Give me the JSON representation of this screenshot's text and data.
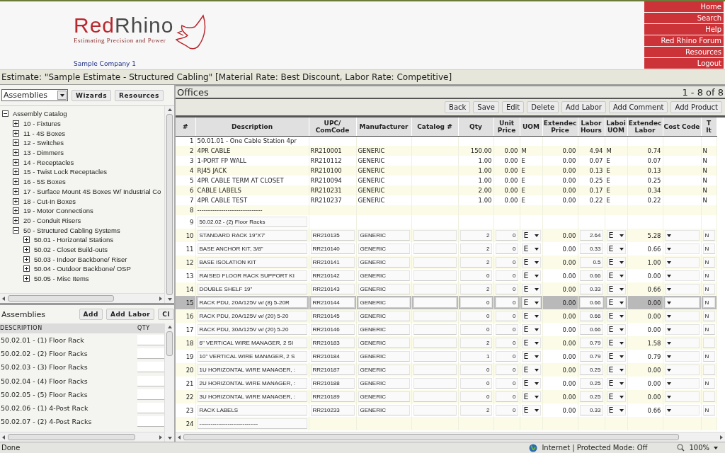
{
  "header": {
    "logo": {
      "part1": "Red",
      "part2": "Rhino",
      "tagline": "Estimating Precision and Power"
    },
    "company": "Sample Company 1",
    "nav": [
      "Home",
      "Search",
      "Help",
      "Red Rhino Forum",
      "Resources",
      "Logout"
    ]
  },
  "estimate_bar": "Estimate: \"Sample Estimate - Structured Cabling\" [Material Rate: Best Discount, Labor Rate: Competitive]",
  "left_panel": {
    "dropdown": "Assemblies",
    "buttons": [
      "Wizards",
      "Resources"
    ],
    "tree": {
      "label": "Assembly Catalog",
      "expanded": true,
      "children": [
        {
          "label": "10 - Fixtures",
          "expanded": false
        },
        {
          "label": "11 - 4S Boxes",
          "expanded": false
        },
        {
          "label": "12 - Switches",
          "expanded": false
        },
        {
          "label": "13 - Dimmers",
          "expanded": false
        },
        {
          "label": "14 - Receptacles",
          "expanded": false
        },
        {
          "label": "15 - Twist Lock Receptacles",
          "expanded": false
        },
        {
          "label": "16 - 5S Boxes",
          "expanded": false
        },
        {
          "label": "17 - Surface Mount 4S Boxes W/ Industrial Co",
          "expanded": false
        },
        {
          "label": "18 - Cut-In Boxes",
          "expanded": false
        },
        {
          "label": "19 - Motor Connections",
          "expanded": false
        },
        {
          "label": "20 - Conduit Risers",
          "expanded": false
        },
        {
          "label": "50 - Structured Cabling Systems",
          "expanded": true,
          "children": [
            {
              "label": "50.01 - Horizontal Stations",
              "expanded": false
            },
            {
              "label": "50.02 - Closet Build-outs",
              "expanded": false
            },
            {
              "label": "50.03 - Indoor Backbone/ Riser",
              "expanded": false
            },
            {
              "label": "50.04 - Outdoor Backbone/ OSP",
              "expanded": false
            },
            {
              "label": "50.05 - Misc Items",
              "expanded": false
            }
          ]
        }
      ]
    }
  },
  "assemblies": {
    "title": "Assemblies",
    "buttons": [
      "Add",
      "Add Labor",
      "Cl"
    ],
    "columns": [
      "DESCRIPTION",
      "QTY"
    ],
    "rows": [
      "50.02.01 - (1) Floor Rack",
      "50.02.02 - (2) Floor Racks",
      "50.02.03 - (3) Floor Racks",
      "50.02.04 - (4) Floor Racks",
      "50.02.05 - (5) Floor Racks",
      "50.02.06 - (1) 4-Post Rack",
      "50.02.07 - (2) 4-Post Racks"
    ]
  },
  "main": {
    "title": "Offices",
    "paging": "1 - 8 of 8",
    "buttons": [
      "Back",
      "Save",
      "Edit",
      "Delete",
      "Add Labor",
      "Add Comment",
      "Add Product"
    ],
    "columns": [
      [
        "#"
      ],
      [
        "Description"
      ],
      [
        "UPC/",
        "ComCode"
      ],
      [
        "Manufacturer"
      ],
      [
        "Catalog #"
      ],
      [
        "Qty"
      ],
      [
        "Unit",
        "Price"
      ],
      [
        "UOM"
      ],
      [
        "Extendec",
        "Price"
      ],
      [
        "Labor",
        "Hours"
      ],
      [
        "Laboi",
        "UOM"
      ],
      [
        "Extendec",
        "Labor"
      ],
      [
        "Cost Code"
      ],
      [
        "T",
        "It"
      ]
    ],
    "rows": [
      {
        "kind": "plain",
        "selected": false,
        "num": "1",
        "description": "50.01.01 - One Cable Station 4pr"
      },
      {
        "kind": "plain",
        "selected": false,
        "num": "2",
        "description": "4PR CABLE",
        "upc": "RR210001",
        "manufacturer": "GENERIC",
        "qty": "150.00",
        "unit_price": "0.00",
        "uom": "M",
        "ext_price": "0.00",
        "labor_hours": "4.94",
        "labor_uom": "M",
        "ext_labor": "0.74",
        "flag": "N"
      },
      {
        "kind": "plain",
        "selected": false,
        "num": "3",
        "description": "1-PORT FP WALL",
        "upc": "RR210112",
        "manufacturer": "GENERIC",
        "qty": "1.00",
        "unit_price": "0.00",
        "uom": "E",
        "ext_price": "0.00",
        "labor_hours": "0.07",
        "labor_uom": "E",
        "ext_labor": "0.07",
        "flag": "N"
      },
      {
        "kind": "plain",
        "selected": false,
        "num": "4",
        "description": "RJ45 JACK",
        "upc": "RR210100",
        "manufacturer": "GENERIC",
        "qty": "1.00",
        "unit_price": "0.00",
        "uom": "E",
        "ext_price": "0.00",
        "labor_hours": "0.13",
        "labor_uom": "E",
        "ext_labor": "0.13",
        "flag": "N"
      },
      {
        "kind": "plain",
        "selected": false,
        "num": "5",
        "description": "4PR CABLE TERM AT CLOSET",
        "upc": "RR210094",
        "manufacturer": "GENERIC",
        "qty": "1.00",
        "unit_price": "0.00",
        "uom": "E",
        "ext_price": "0.00",
        "labor_hours": "0.25",
        "labor_uom": "E",
        "ext_labor": "0.25",
        "flag": "N"
      },
      {
        "kind": "plain",
        "selected": false,
        "num": "6",
        "description": "CABLE LABELS",
        "upc": "RR210231",
        "manufacturer": "GENERIC",
        "qty": "2.00",
        "unit_price": "0.00",
        "uom": "E",
        "ext_price": "0.00",
        "labor_hours": "0.17",
        "labor_uom": "E",
        "ext_labor": "0.34",
        "flag": "N"
      },
      {
        "kind": "plain",
        "selected": false,
        "num": "7",
        "description": "4PR CABLE TEST",
        "upc": "RR210237",
        "manufacturer": "GENERIC",
        "qty": "1.00",
        "unit_price": "0.00",
        "uom": "E",
        "ext_price": "0.00",
        "labor_hours": "0.22",
        "labor_uom": "E",
        "ext_labor": "0.22",
        "flag": "N"
      },
      {
        "kind": "plain",
        "selected": false,
        "num": "8",
        "description": "------------------------------"
      },
      {
        "kind": "label",
        "selected": false,
        "num": "9",
        "description": "50.02.02 - (2) Floor Racks"
      },
      {
        "kind": "entry",
        "selected": false,
        "num": "10",
        "description": "STANDARD RACK 19\"X7'",
        "upc": "RR210135",
        "manufacturer": "GENERIC",
        "qty": "2",
        "unit_price": "0",
        "uom": "E",
        "ext_price": "0.00",
        "labor_hours": "2.64",
        "labor_uom": "E",
        "ext_labor": "5.28",
        "flag": "N"
      },
      {
        "kind": "entry",
        "selected": false,
        "num": "11",
        "description": "BASE ANCHOR KIT, 3/8\"",
        "upc": "RR210140",
        "manufacturer": "GENERIC",
        "qty": "2",
        "unit_price": "0",
        "uom": "E",
        "ext_price": "0.00",
        "labor_hours": "0.33",
        "labor_uom": "E",
        "ext_labor": "0.66",
        "flag": "N"
      },
      {
        "kind": "entry",
        "selected": false,
        "num": "12",
        "description": "BASE ISOLATION KIT",
        "upc": "RR210141",
        "manufacturer": "GENERIC",
        "qty": "2",
        "unit_price": "0",
        "uom": "E",
        "ext_price": "0.00",
        "labor_hours": "0.5",
        "labor_uom": "E",
        "ext_labor": "1.00",
        "flag": "N"
      },
      {
        "kind": "entry",
        "selected": false,
        "num": "13",
        "description": "RAISED FLOOR RACK SUPPORT KI",
        "upc": "RR210142",
        "manufacturer": "GENERIC",
        "qty": "0",
        "unit_price": "0",
        "uom": "E",
        "ext_price": "0.00",
        "labor_hours": "0.66",
        "labor_uom": "E",
        "ext_labor": "0.00",
        "flag": "N"
      },
      {
        "kind": "entry",
        "selected": false,
        "num": "14",
        "description": "DOUBLE SHELF 19\"",
        "upc": "RR210143",
        "manufacturer": "GENERIC",
        "qty": "2",
        "unit_price": "0",
        "uom": "E",
        "ext_price": "0.00",
        "labor_hours": "0.33",
        "labor_uom": "E",
        "ext_labor": "0.66",
        "flag": "N"
      },
      {
        "kind": "entry",
        "selected": true,
        "num": "15",
        "description": "RACK PDU, 20A/125V w/ (8) 5-20R",
        "upc": "RR210144",
        "manufacturer": "GENERIC",
        "qty": "0",
        "unit_price": "0",
        "uom": "E",
        "ext_price": "0.00",
        "labor_hours": "0.66",
        "labor_uom": "E",
        "ext_labor": "0.00",
        "flag": "N"
      },
      {
        "kind": "entry",
        "selected": false,
        "num": "16",
        "description": "RACK PDU, 20A/125V w/ (20) 5-20",
        "upc": "RR210145",
        "manufacturer": "GENERIC",
        "qty": "0",
        "unit_price": "0",
        "uom": "E",
        "ext_price": "0.00",
        "labor_hours": "0.66",
        "labor_uom": "E",
        "ext_labor": "0.00",
        "flag": "N"
      },
      {
        "kind": "entry",
        "selected": false,
        "num": "17",
        "description": "RACK PDU, 30A/125V w/ (20) 5-20",
        "upc": "RR210146",
        "manufacturer": "GENERIC",
        "qty": "0",
        "unit_price": "0",
        "uom": "E",
        "ext_price": "0.00",
        "labor_hours": "0.66",
        "labor_uom": "E",
        "ext_labor": "0.00",
        "flag": "N"
      },
      {
        "kind": "entry",
        "selected": false,
        "num": "18",
        "description": "6\" VERTICAL WIRE MANAGER, 2 SI",
        "upc": "RR210183",
        "manufacturer": "GENERIC",
        "qty": "2",
        "unit_price": "0",
        "uom": "E",
        "ext_price": "0.00",
        "labor_hours": "0.79",
        "labor_uom": "E",
        "ext_labor": "1.58"
      },
      {
        "kind": "entry",
        "selected": false,
        "num": "19",
        "description": "10\" VERTICAL WIRE MANAGER, 2 S",
        "upc": "RR210184",
        "manufacturer": "GENERIC",
        "qty": "1",
        "unit_price": "0",
        "uom": "E",
        "ext_price": "0.00",
        "labor_hours": "0.79",
        "labor_uom": "E",
        "ext_labor": "0.79",
        "flag": "N"
      },
      {
        "kind": "entry",
        "selected": false,
        "num": "20",
        "description": "1U HORIZONTAL WIRE MANAGER, :",
        "upc": "RR210187",
        "manufacturer": "GENERIC",
        "qty": "0",
        "unit_price": "0",
        "uom": "E",
        "ext_price": "0.00",
        "labor_hours": "0.25",
        "labor_uom": "E",
        "ext_labor": "0.00"
      },
      {
        "kind": "entry",
        "selected": false,
        "num": "21",
        "description": "2U HORIZONTAL WIRE MANAGER, :",
        "upc": "RR210188",
        "manufacturer": "GENERIC",
        "qty": "0",
        "unit_price": "0",
        "uom": "E",
        "ext_price": "0.00",
        "labor_hours": "0.25",
        "labor_uom": "E",
        "ext_labor": "0.00",
        "flag": "N"
      },
      {
        "kind": "entry",
        "selected": false,
        "num": "22",
        "description": "3U HORIZONTAL WIRE MANAGER, :",
        "upc": "RR210189",
        "manufacturer": "GENERIC",
        "qty": "0",
        "unit_price": "0",
        "uom": "E",
        "ext_price": "0.00",
        "labor_hours": "0.25",
        "labor_uom": "E",
        "ext_labor": "0.00"
      },
      {
        "kind": "entry",
        "selected": false,
        "num": "23",
        "description": "RACK LABELS",
        "upc": "RR210233",
        "manufacturer": "GENERIC",
        "qty": "2",
        "unit_price": "0",
        "uom": "E",
        "ext_price": "0.00",
        "labor_hours": "0.33",
        "labor_uom": "E",
        "ext_labor": "0.66",
        "flag": "N"
      },
      {
        "kind": "label",
        "selected": false,
        "num": "24",
        "description": "-------------------------------"
      }
    ]
  },
  "status_bar": {
    "text": "Done",
    "zone": "Internet | Protected Mode: Off",
    "zoom": "100%"
  }
}
